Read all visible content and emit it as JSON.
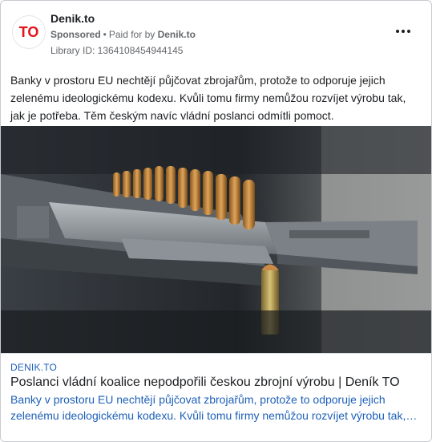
{
  "ad": {
    "page_name": "Denik.to",
    "sponsored": "Sponsored",
    "dot": "•",
    "paid_for_by": "Paid for by",
    "payer": "Denik.to",
    "library_id": "Library ID: 1364108454944145",
    "body": "Banky v prostoru EU nechtějí půjčovat zbrojařům, protože to odporuje jejich zelenému ideologickému kodexu. Kvůli tomu firmy nemůžou rozvíjet výrobu tak, jak je potřeba. Těm českým navíc vládní poslanci odmítli pomoct.",
    "logo_text": "TO",
    "logo_color": "#e3151a"
  },
  "link": {
    "domain": "DENIK.TO",
    "title": "Poslanci vládní koalice nepodpořili českou zbrojní výrobu | Deník TO",
    "description": "Banky v prostoru EU nechtějí půjčovat zbrojařům, protože to odporuje jejich zelenému ideologickému kodexu. Kvůli tomu firmy nemůžou rozvíjet výrobu tak, jak je potřeba. Těm českým navíc vládní poslanci odmítli pomoct."
  },
  "colors": {
    "link_blue": "#1c5fb8",
    "muted": "#65676b",
    "text": "#1c1e21"
  }
}
